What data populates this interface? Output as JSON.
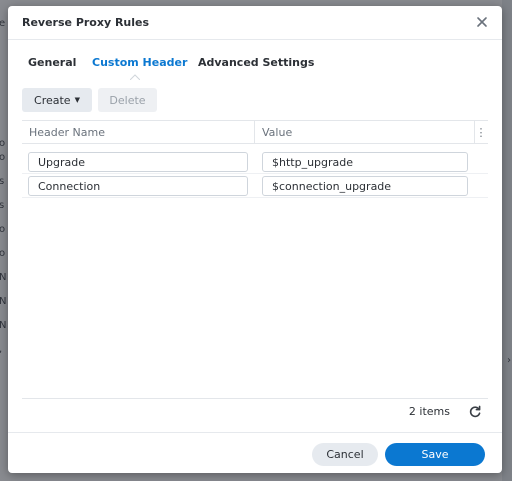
{
  "dialog": {
    "title": "Reverse Proxy Rules",
    "close_icon": "close-icon"
  },
  "tabs": [
    {
      "label": "General",
      "active": false
    },
    {
      "label": "Custom Header",
      "active": true
    },
    {
      "label": "Advanced Settings",
      "active": false
    }
  ],
  "toolbar": {
    "create_label": "Create",
    "delete_label": "Delete",
    "delete_disabled": true
  },
  "grid": {
    "columns": [
      "Header Name",
      "Value"
    ],
    "rows": [
      {
        "name": "Upgrade",
        "value": "$http_upgrade"
      },
      {
        "name": "Connection",
        "value": "$connection_upgrade"
      }
    ],
    "count_text": "2 items"
  },
  "footer": {
    "cancel_label": "Cancel",
    "save_label": "Save"
  },
  "colors": {
    "accent": "#0b78d1",
    "overlay": "#5a5e63"
  }
}
